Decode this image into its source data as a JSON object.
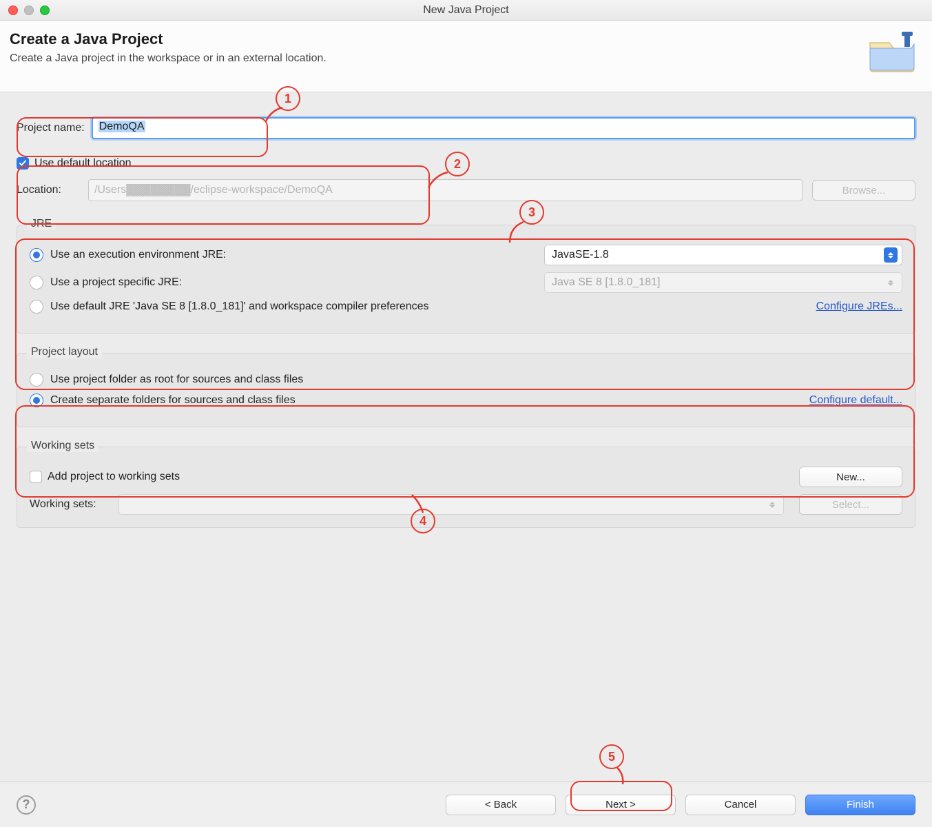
{
  "window": {
    "title": "New Java Project"
  },
  "header": {
    "title": "Create a Java Project",
    "subtitle": "Create a Java project in the workspace or in an external location."
  },
  "project_name": {
    "label": "Project name:",
    "value": "DemoQA"
  },
  "use_default_location": {
    "label": "Use default location",
    "checked": true
  },
  "location": {
    "label": "Location:",
    "value": "/Users▓▓▓▓▓▓▓▓/eclipse-workspace/DemoQA",
    "browse": "Browse..."
  },
  "jre": {
    "title": "JRE",
    "opt_exec_env": "Use an execution environment JRE:",
    "exec_env_value": "JavaSE-1.8",
    "opt_project_specific": "Use a project specific JRE:",
    "project_specific_value": "Java SE 8 [1.8.0_181]",
    "opt_default": "Use default JRE 'Java SE 8 [1.8.0_181]' and workspace compiler preferences",
    "configure_link": "Configure JREs..."
  },
  "project_layout": {
    "title": "Project layout",
    "opt_root": "Use project folder as root for sources and class files",
    "opt_separate": "Create separate folders for sources and class files",
    "configure_link": "Configure default..."
  },
  "working_sets": {
    "title": "Working sets",
    "checkbox_label": "Add project to working sets",
    "new_button": "New...",
    "label": "Working sets:",
    "select_button": "Select..."
  },
  "buttons": {
    "back": "< Back",
    "next": "Next >",
    "cancel": "Cancel",
    "finish": "Finish"
  },
  "annotations": [
    "1",
    "2",
    "3",
    "4",
    "5"
  ]
}
